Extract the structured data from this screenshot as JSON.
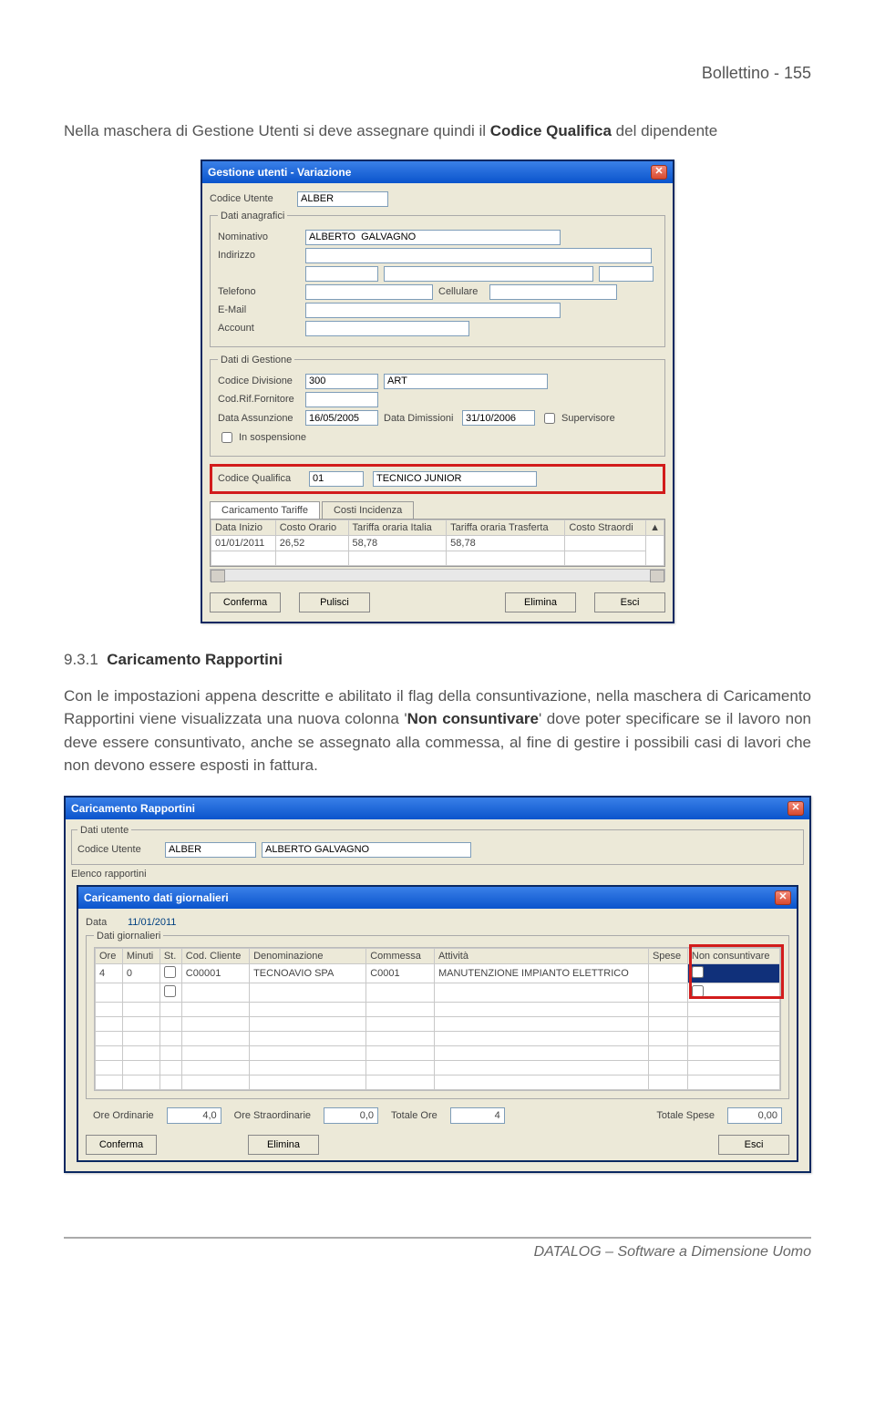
{
  "header": {
    "doc_title": "Bollettino  - 155"
  },
  "para1": {
    "pre": "Nella maschera di Gestione Utenti si deve assegnare quindi il ",
    "bold": "Codice Qualifica",
    "post": " del dipendente"
  },
  "win1": {
    "title": "Gestione utenti - Variazione",
    "labels": {
      "codice_utente": "Codice Utente",
      "dati_anagrafici": "Dati anagrafici",
      "nominativo": "Nominativo",
      "indirizzo": "Indirizzo",
      "telefono": "Telefono",
      "cellulare": "Cellulare",
      "email": "E-Mail",
      "account": "Account",
      "dati_gestione": "Dati di Gestione",
      "codice_divisione": "Codice Divisione",
      "cod_rif_fornitore": "Cod.Rif.Fornitore",
      "data_assunzione": "Data Assunzione",
      "data_dimissioni": "Data Dimissioni",
      "supervisore": "Supervisore",
      "in_sospensione": "In sospensione",
      "codice_qualifica": "Codice Qualifica",
      "tab_tariffe": "Caricamento Tariffe",
      "tab_costi": "Costi Incidenza"
    },
    "values": {
      "codice_utente": "ALBER",
      "nominativo": "ALBERTO  GALVAGNO",
      "codice_divisione_num": "300",
      "codice_divisione_desc": "ART",
      "data_assunzione": "16/05/2005",
      "data_dimissioni": "31/10/2006",
      "codice_qualifica_num": "01",
      "codice_qualifica_desc": "TECNICO JUNIOR"
    },
    "grid": {
      "headers": [
        "Data Inizio",
        "Costo Orario",
        "Tariffa oraria Italia",
        "Tariffa oraria Trasferta",
        "Costo Straordi"
      ],
      "row": [
        "01/01/2011",
        "26,52",
        "58,78",
        "58,78",
        ""
      ]
    },
    "buttons": {
      "conferma": "Conferma",
      "pulisci": "Pulisci",
      "elimina": "Elimina",
      "esci": "Esci"
    }
  },
  "section": {
    "num": "9.3.1",
    "title": "Caricamento Rapportini"
  },
  "para2": {
    "t1": "Con le impostazioni appena descritte e abilitato il flag della consuntivazione, nella maschera di Caricamento Rapportini viene visualizzata una nuova colonna '",
    "bold1": "Non consuntivare",
    "t2": "' dove poter specificare se il lavoro non deve essere consuntivato, anche se assegnato alla commessa, al fine di gestire i possibili casi di  lavori che non devono essere esposti in fattura."
  },
  "win2": {
    "title_outer": "Caricamento Rapportini",
    "title_inner": "Caricamento dati giornalieri",
    "labels": {
      "dati_utente": "Dati utente",
      "codice_utente": "Codice Utente",
      "elenco": "Elenco rapportini",
      "data": "Data",
      "dati_giornalieri": "Dati giornalieri"
    },
    "values": {
      "codice_utente": "ALBER",
      "nome": "ALBERTO GALVAGNO",
      "data": "11/01/2011"
    },
    "grid": {
      "headers": [
        "Ore",
        "Minuti",
        "St.",
        "Cod. Cliente",
        "Denominazione",
        "Commessa",
        "Attività",
        "Spese",
        "Non consuntivare"
      ],
      "row": [
        "4",
        "0",
        "",
        "C00001",
        "TECNOAVIO SPA",
        "C0001",
        "MANUTENZIONE IMPIANTO ELETTRICO",
        "",
        ""
      ]
    },
    "totals": {
      "ore_ordinarie_lbl": "Ore Ordinarie",
      "ore_ordinarie": "4,0",
      "ore_straord_lbl": "Ore Straordinarie",
      "ore_straord": "0,0",
      "totale_ore_lbl": "Totale Ore",
      "totale_ore": "4",
      "totale_spese_lbl": "Totale Spese",
      "totale_spese": "0,00"
    },
    "buttons": {
      "conferma": "Conferma",
      "elimina": "Elimina",
      "esci": "Esci"
    }
  },
  "footer": "DATALOG – Software a Dimensione Uomo"
}
